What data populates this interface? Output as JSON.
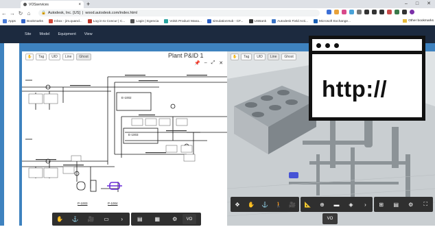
{
  "browser": {
    "tab_title": "VOSservices",
    "url": "wood.autodesk.com/index.html",
    "site_label": "Autodesk, Inc. [US]",
    "bookmarks": [
      "Apps",
      "Bookmarks",
      "Inbox - jim.quand...",
      "Log in to Concur | C...",
      "Login | Egencia",
      "Volvk Product Mana...",
      "simulationHub - CF...",
      "USBank",
      "Autodesk Field Acti...",
      "Microsoft Exchange..."
    ],
    "other_bookmarks": "Other bookmarks"
  },
  "app_nav": [
    "Site",
    "Model",
    "Equipment",
    "View"
  ],
  "pid_panel": {
    "title": "Plant P&ID 1",
    "toggles": [
      "Tag",
      "UID",
      "Line",
      "Ghost"
    ],
    "labels": [
      "E-1002",
      "E-1003",
      "P-1003",
      "P-1004"
    ]
  },
  "model_panel": {
    "toggles": [
      "Tag",
      "UID",
      "Line",
      "Ghost"
    ],
    "bottom_label": "VO"
  },
  "pid_bottom_label": "VO",
  "overlay_text": "http://",
  "colors": {
    "app_nav_bg": "#1c2a3f",
    "workspace_blue": "#3e82bf",
    "toolbar_dark": "#2f2f2f"
  }
}
